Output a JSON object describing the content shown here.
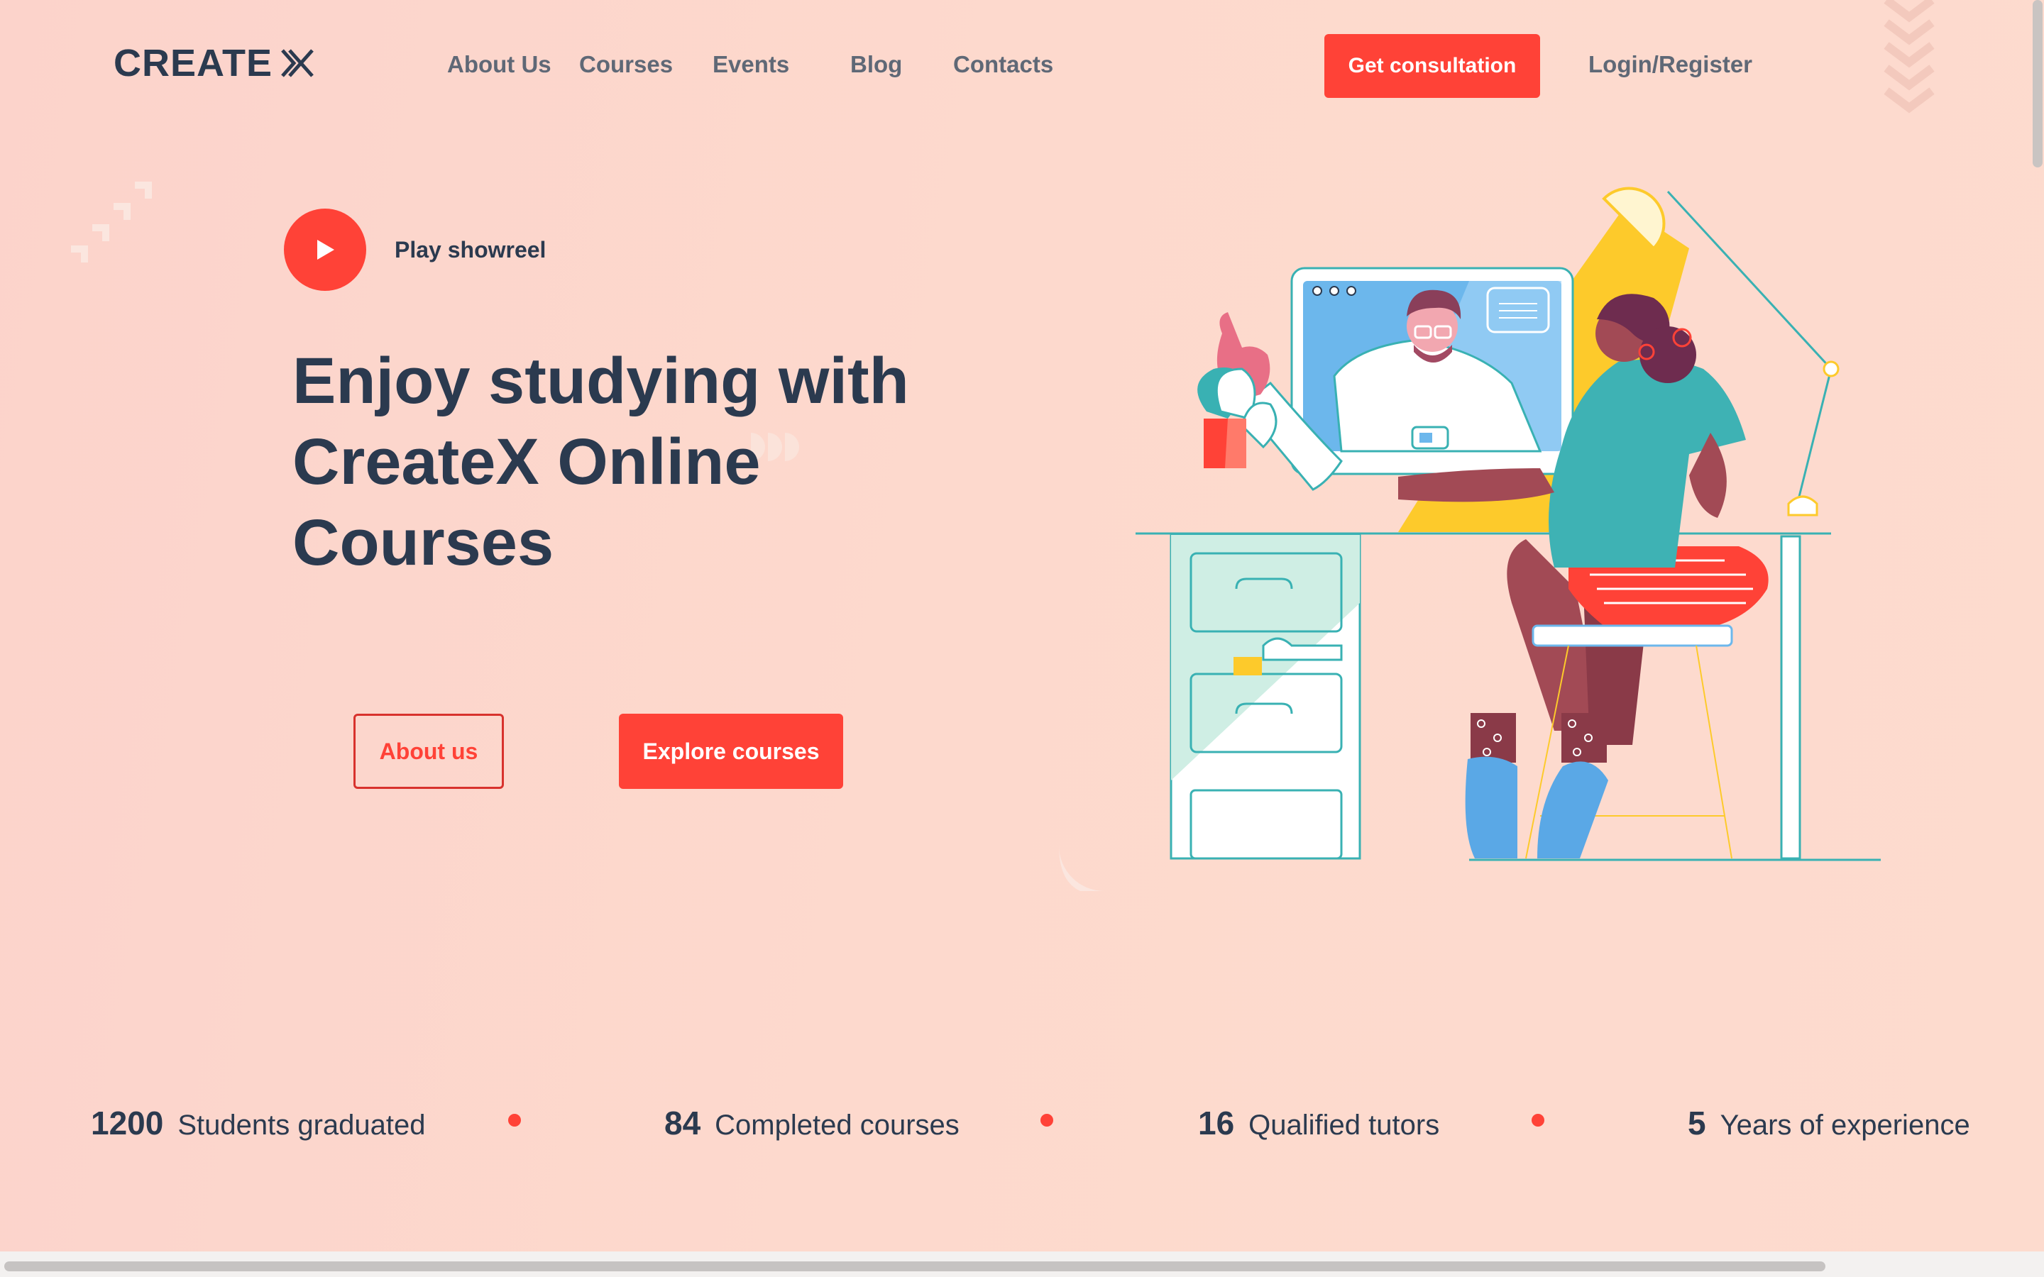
{
  "header": {
    "logo_text": "CREATE",
    "logo_icon": "createx-x-mark",
    "nav": [
      {
        "label": "About Us"
      },
      {
        "label": "Courses"
      },
      {
        "label": "Events"
      },
      {
        "label": "Blog"
      },
      {
        "label": "Contacts"
      }
    ],
    "cta_label": "Get consultation",
    "login_label": "Login/Register"
  },
  "hero": {
    "showreel_label": "Play showreel",
    "showreel_icon": "play-icon",
    "title_lines": [
      "Enjoy studying with",
      "CreateX Online",
      "Courses"
    ],
    "about_button": "About us",
    "explore_button": "Explore courses",
    "illustration": "student-at-desk-video-call"
  },
  "stats": [
    {
      "value": "1200",
      "label": "Students graduated"
    },
    {
      "value": "84",
      "label": "Completed courses"
    },
    {
      "value": "16",
      "label": "Qualified tutors"
    },
    {
      "value": "5",
      "label": "Years of experience"
    }
  ],
  "colors": {
    "accent": "#ff4237",
    "text_dark": "#2b3a4f",
    "nav_text": "#5f6876",
    "background": "#fdd9cd"
  }
}
